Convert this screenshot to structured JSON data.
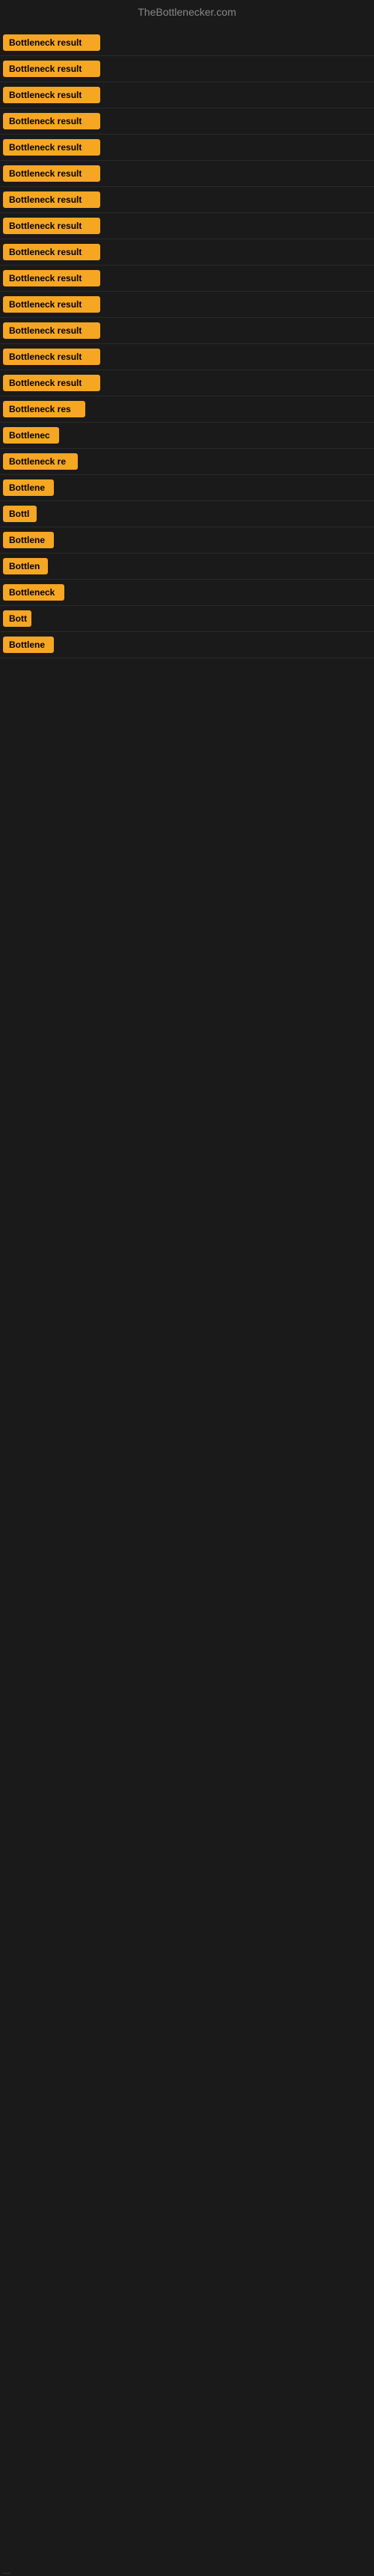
{
  "header": {
    "title": "TheBottlenecker.com"
  },
  "items": [
    {
      "label": "Bottleneck result",
      "width": 130
    },
    {
      "label": "Bottleneck result",
      "width": 130
    },
    {
      "label": "Bottleneck result",
      "width": 130
    },
    {
      "label": "Bottleneck result",
      "width": 130
    },
    {
      "label": "Bottleneck result",
      "width": 130
    },
    {
      "label": "Bottleneck result",
      "width": 130
    },
    {
      "label": "Bottleneck result",
      "width": 130
    },
    {
      "label": "Bottleneck result",
      "width": 130
    },
    {
      "label": "Bottleneck result",
      "width": 130
    },
    {
      "label": "Bottleneck result",
      "width": 130
    },
    {
      "label": "Bottleneck result",
      "width": 130
    },
    {
      "label": "Bottleneck result",
      "width": 130
    },
    {
      "label": "Bottleneck result",
      "width": 130
    },
    {
      "label": "Bottleneck result",
      "width": 130
    },
    {
      "label": "Bottleneck res",
      "width": 110
    },
    {
      "label": "Bottlenec",
      "width": 75
    },
    {
      "label": "Bottleneck re",
      "width": 100
    },
    {
      "label": "Bottlene",
      "width": 68
    },
    {
      "label": "Bottl",
      "width": 45
    },
    {
      "label": "Bottlene",
      "width": 68
    },
    {
      "label": "Bottlen",
      "width": 60
    },
    {
      "label": "Bottleneck",
      "width": 82
    },
    {
      "label": "Bott",
      "width": 38
    },
    {
      "label": "Bottlene",
      "width": 68
    }
  ],
  "ellipsis": "..."
}
